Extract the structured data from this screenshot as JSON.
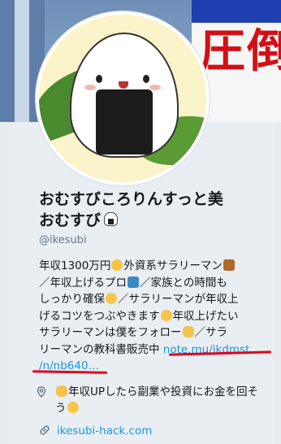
{
  "header": {
    "banner_text": "圧倒"
  },
  "profile": {
    "name_line1": "おむすびころりんすっと美",
    "name_line2": "おむすび",
    "handle": "@ikesubi",
    "bio": {
      "segment1": "年収1300万円",
      "segment2": "外資系サラリーマン",
      "segment3": "／年収上げるプロ",
      "segment4": "／家族との時間も",
      "segment5": "しっかり確保",
      "segment6": "／サラリーマンが年収上",
      "segment7": "げるコツをつぶやきます",
      "segment8": "年収上げたい",
      "segment9": "サラリーマンは僕をフォロー",
      "segment10": "／サラ",
      "segment11": "リーマンの教科書販売中",
      "link_line1": "note.mu/ikdmst",
      "link_line2": "/n/nb640…"
    },
    "location": "年収UPしたら副業や投資にお金を回そう",
    "website": "ikesubi-hack.com"
  },
  "icons": {
    "location_icon": "map-pin-icon",
    "website_icon": "link-icon",
    "accent_link_color": "#1b95e0",
    "annotation_color": "#e3001b"
  }
}
